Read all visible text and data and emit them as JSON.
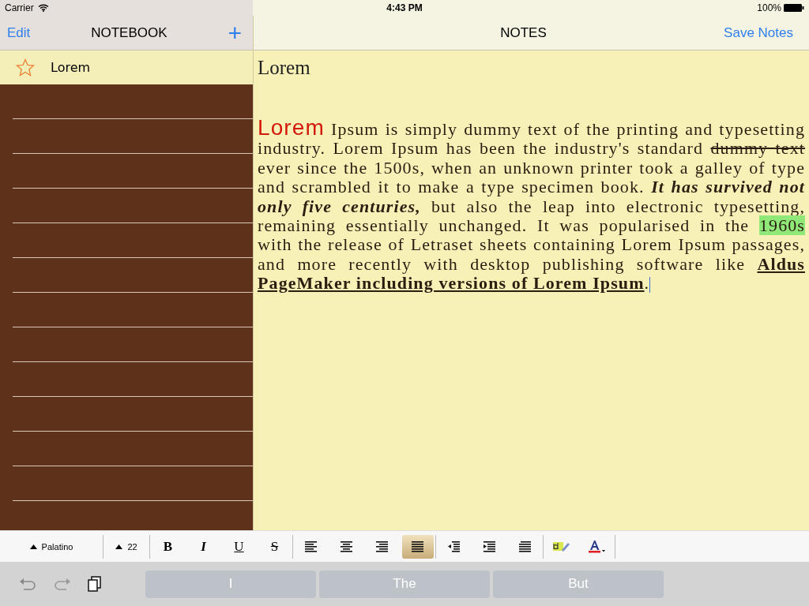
{
  "status_bar": {
    "carrier": "Carrier",
    "time": "4:43 PM",
    "battery": "100%"
  },
  "sidebar": {
    "edit": "Edit",
    "title": "NOTEBOOK",
    "add": "+",
    "items": [
      {
        "label": "Lorem"
      }
    ]
  },
  "editor": {
    "title": "NOTES",
    "save": "Save Notes",
    "note_title": "Lorem",
    "body": [
      {
        "text": "Lorem",
        "kind": "large"
      },
      {
        "text": " Ipsum is simply dummy text of the printing and typesetting industry. Lorem Ipsum has been the industry's standard ",
        "kind": "plain"
      },
      {
        "text": "dummy text",
        "kind": "strike"
      },
      {
        "text": " ever since the 1500s, when an unknown printer took a galley of type and scrambled it to make a type specimen book. ",
        "kind": "plain"
      },
      {
        "text": "It has survived not only five centuries,",
        "kind": "bolditalic"
      },
      {
        "text": " but also the leap into electronic typesetting, remaining essentially unchanged. It was popularised in the ",
        "kind": "plain"
      },
      {
        "text": "1960s",
        "kind": "highlight"
      },
      {
        "text": " with the release of Letraset sheets containing Lorem Ipsum passages, and more recently with desktop publishing software like ",
        "kind": "plain"
      },
      {
        "text": "Aldus PageMaker including versions of Lorem Ipsum",
        "kind": "boldunderline"
      },
      {
        "text": ".",
        "kind": "plain"
      }
    ]
  },
  "toolbar": {
    "font": "Palatino",
    "size": "22",
    "styles": [
      {
        "label": "B",
        "kind": "bold"
      },
      {
        "label": "I",
        "kind": "italic"
      },
      {
        "label": "U",
        "kind": "underline"
      },
      {
        "label": "S",
        "kind": "strike"
      }
    ],
    "alignments": [
      {
        "kind": "left",
        "selected": false
      },
      {
        "kind": "center",
        "selected": false
      },
      {
        "kind": "right",
        "selected": false
      },
      {
        "kind": "justify",
        "selected": true
      }
    ],
    "indents": [
      {
        "kind": "outdent"
      },
      {
        "kind": "indent"
      },
      {
        "kind": "list"
      }
    ]
  },
  "suggestions": [
    "I",
    "The",
    "But"
  ]
}
